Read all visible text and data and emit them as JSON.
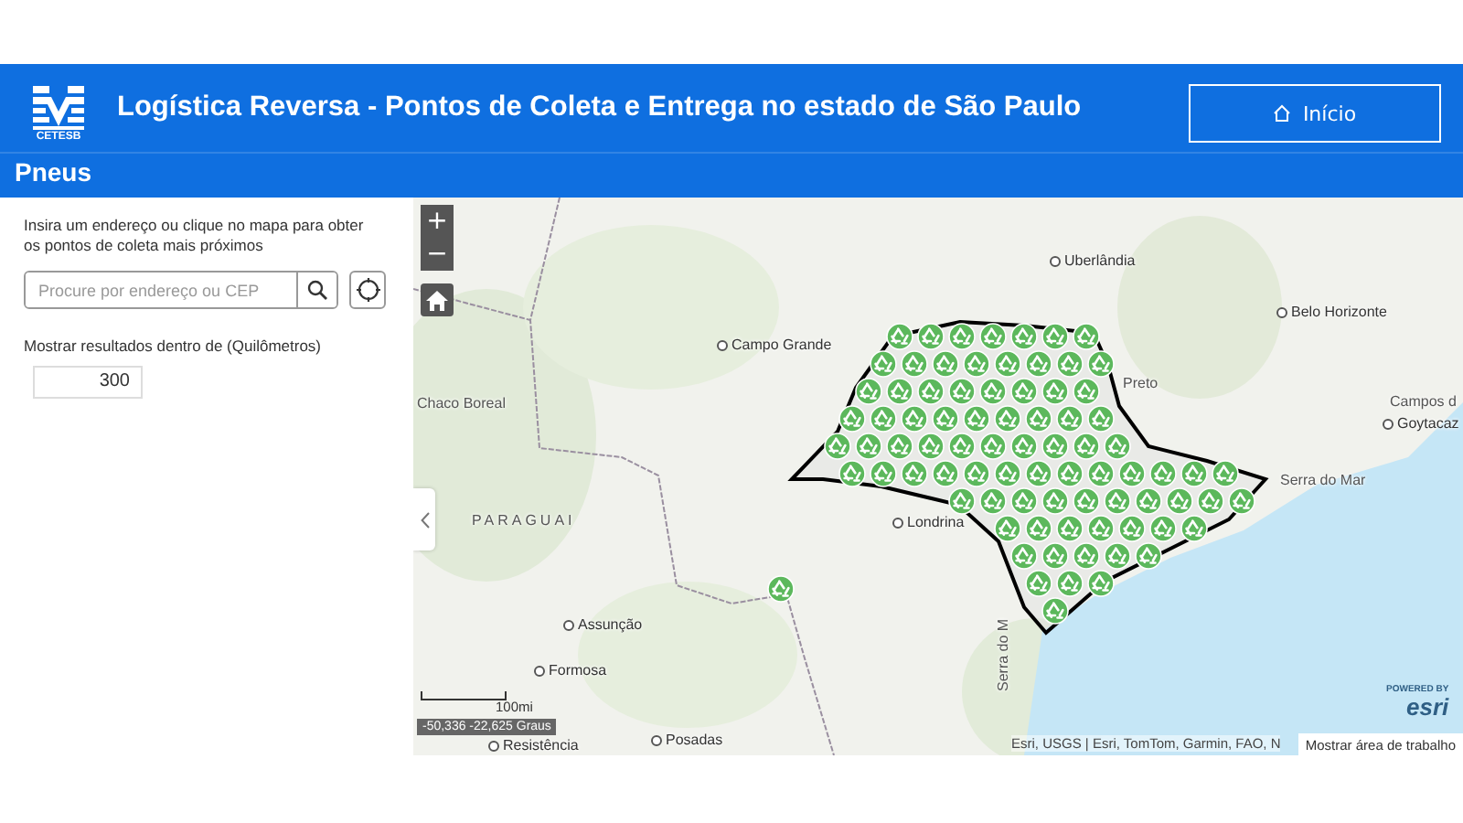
{
  "header": {
    "logo_text": "CETESB",
    "title": "Logística Reversa - Pontos de Coleta e Entrega no estado de São Paulo",
    "home_button": "Início"
  },
  "subtitle": "Pneus",
  "panel": {
    "instructions": "Insira um endereço ou clique no mapa para obter os pontos de coleta mais próximos",
    "search": {
      "placeholder": "Procure por endereço ou CEP"
    },
    "distance_label": "Mostrar resultados dentro de (Quilômetros)",
    "distance": {
      "value": "300"
    }
  },
  "map": {
    "zoom_in": "+",
    "zoom_out": "−",
    "labels": [
      {
        "text": "Uberlândia",
        "kind": "city"
      },
      {
        "text": "Campo Grande",
        "kind": "city"
      },
      {
        "text": "Belo Horizonte",
        "kind": "city"
      },
      {
        "text": "Preto",
        "kind": "region"
      },
      {
        "text": "Campos d",
        "kind": "region"
      },
      {
        "text": "Goytacaz",
        "kind": "city"
      },
      {
        "text": "Chaco Boreal",
        "kind": "region"
      },
      {
        "text": "PARAGUAI",
        "kind": "country"
      },
      {
        "text": "Londrina",
        "kind": "city"
      },
      {
        "text": "Serra do Mar",
        "kind": "region"
      },
      {
        "text": "Serra do M",
        "kind": "region"
      },
      {
        "text": "Assunção",
        "kind": "city"
      },
      {
        "text": "Formosa",
        "kind": "city"
      },
      {
        "text": "Resistência",
        "kind": "city"
      },
      {
        "text": "Posadas",
        "kind": "city"
      }
    ],
    "scale_label": "100mi",
    "coordinates": "-50,336 -22,625 Graus",
    "attribution": "Esri, USGS | Esri, TomTom, Garmin, FAO, N",
    "powered_by": "POWERED BY",
    "esri_logo": "esri",
    "workspace_button": "Mostrar área de trabalho"
  }
}
